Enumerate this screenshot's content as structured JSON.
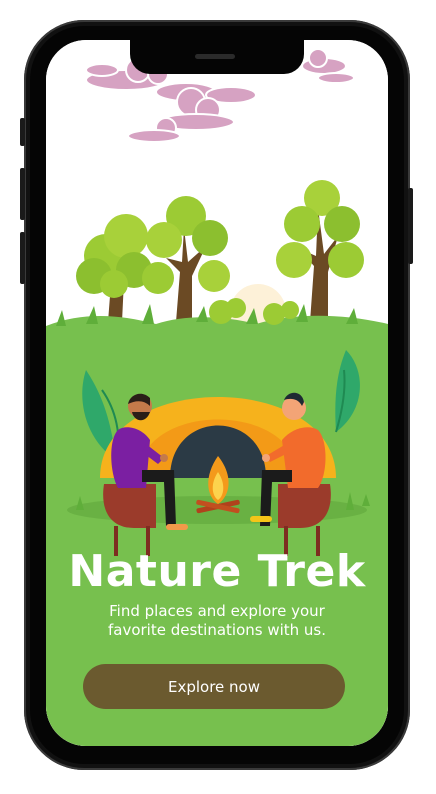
{
  "onboarding": {
    "title": "Nature Trek",
    "subtitle": "Find places and explore your favorite destinations with us.",
    "cta_label": "Explore now"
  },
  "colors": {
    "grass": "#77c04e",
    "cta_background": "#6b5a2f",
    "tent": "#f6b21c",
    "tent_door": "#2b3a45",
    "cloud_pink": "#d6a2c2",
    "text": "#ffffff"
  },
  "illustration": {
    "name": "camping-scene",
    "elements": [
      "clouds",
      "trees",
      "tent",
      "campfire",
      "hiker-left",
      "hiker-right",
      "chairs",
      "bushes"
    ]
  }
}
